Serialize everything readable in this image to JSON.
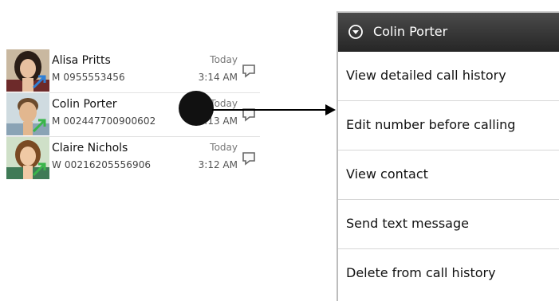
{
  "call_log": {
    "entries": [
      {
        "name": "Alisa Pritts",
        "number": "M 0955553456",
        "date": "Today",
        "time": "3:14 AM"
      },
      {
        "name": "Colin Porter",
        "number": "M 002447700900602",
        "date": "Today",
        "time": "3:13 AM"
      },
      {
        "name": "Claire Nichols",
        "number": "W 00216205556906",
        "date": "Today",
        "time": "3:12 AM"
      }
    ]
  },
  "context_menu": {
    "title": "Colin Porter",
    "items": [
      {
        "label": "View detailed call history"
      },
      {
        "label": "Edit number before calling"
      },
      {
        "label": "View contact"
      },
      {
        "label": "Send text message"
      },
      {
        "label": "Delete from call history"
      }
    ]
  },
  "icons": {
    "outgoing_call": "outgoing-call-arrow-icon",
    "message": "message-icon",
    "menu_header": "chevron-down-circle-icon"
  },
  "colors": {
    "call_arrow": "#39b54a",
    "missed_arrow": "#2f7fd6",
    "menu_header": "#333333"
  }
}
